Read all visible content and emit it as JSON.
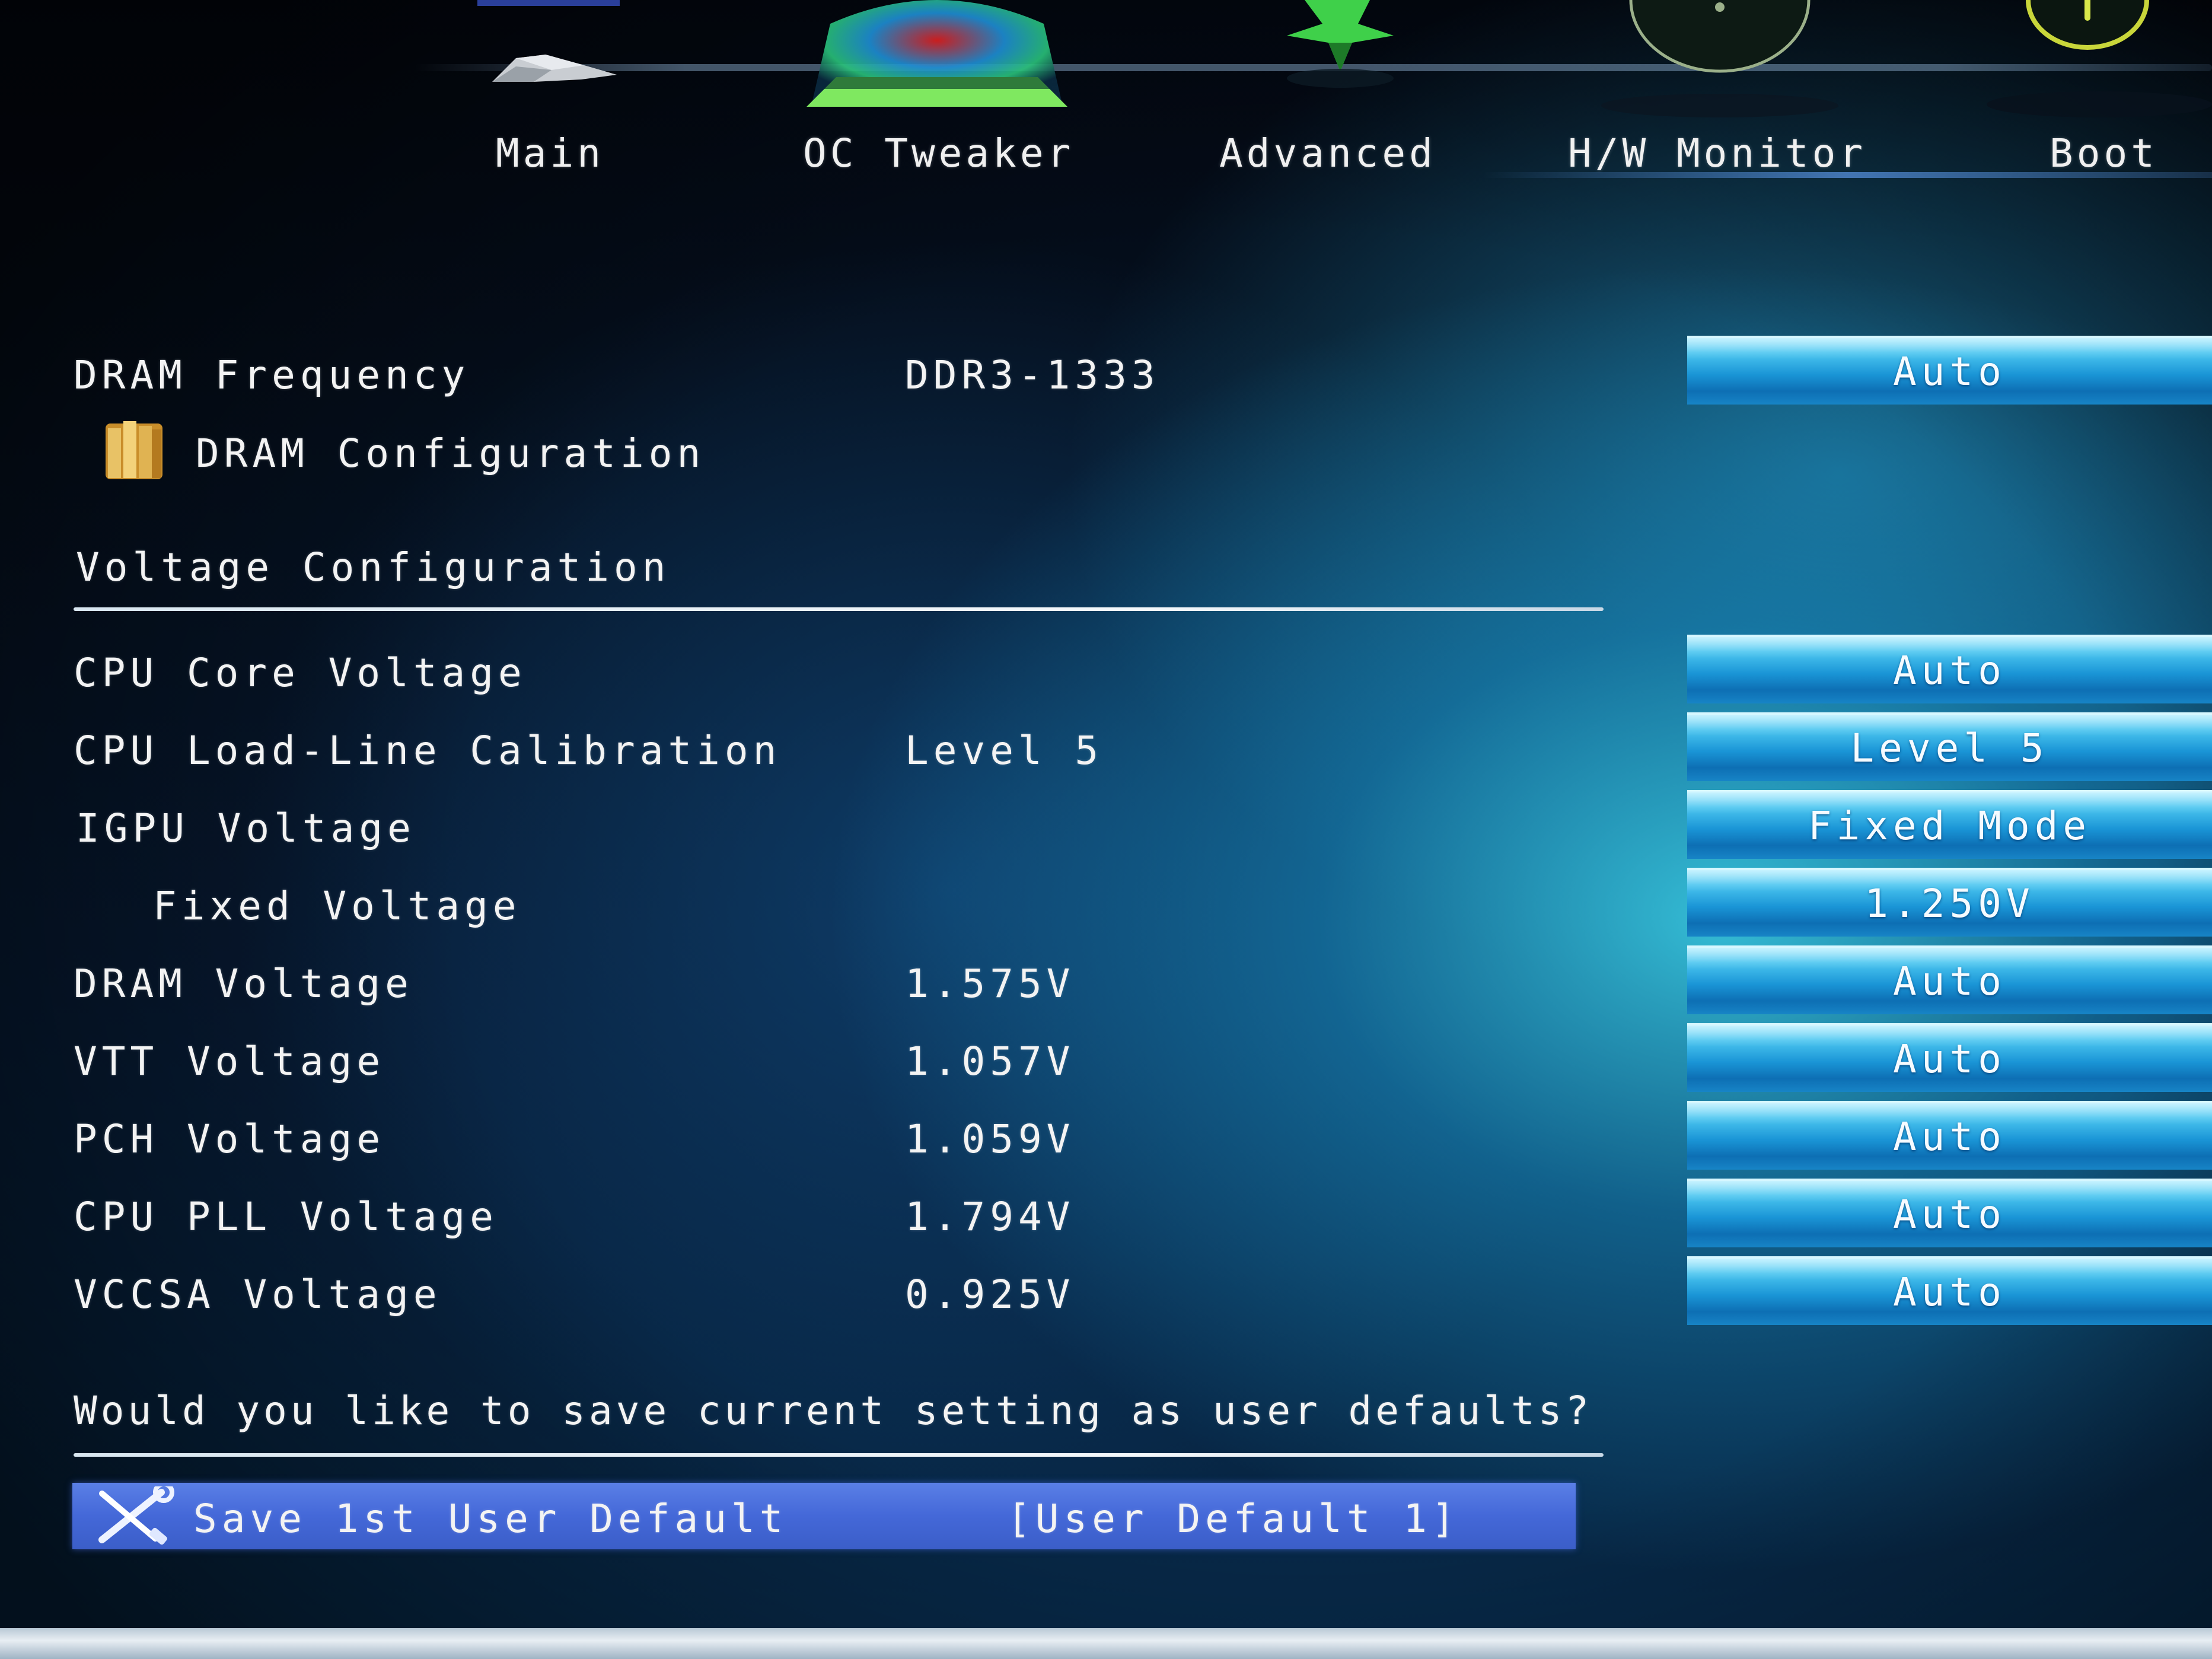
{
  "nav": {
    "tabs": [
      {
        "label": "Main",
        "icon": "chip-icon"
      },
      {
        "label": "OC Tweaker",
        "icon": "gauge-icon"
      },
      {
        "label": "Advanced",
        "icon": "star-icon"
      },
      {
        "label": "H/W Monitor",
        "icon": "monitor-gauge-icon"
      },
      {
        "label": "Boot",
        "icon": "power-icon"
      }
    ]
  },
  "settings": {
    "dram_frequency": {
      "label": "DRAM Frequency",
      "value": "DDR3-1333",
      "option": "Auto"
    },
    "dram_configuration": {
      "label": "DRAM Configuration",
      "icon": "folder-icon"
    },
    "voltage_section": {
      "label": "Voltage Configuration"
    },
    "rows": [
      {
        "label": "CPU Core Voltage",
        "value": "",
        "option": "Auto"
      },
      {
        "label": "CPU Load-Line Calibration",
        "value": "Level 5",
        "option": "Level 5"
      },
      {
        "label": "IGPU Voltage",
        "value": "",
        "option": "Fixed Mode"
      },
      {
        "label": "Fixed Voltage",
        "value": "",
        "option": "1.250V"
      },
      {
        "label": "DRAM Voltage",
        "value": "1.575V",
        "option": "Auto"
      },
      {
        "label": "VTT Voltage",
        "value": "1.057V",
        "option": "Auto"
      },
      {
        "label": "PCH Voltage",
        "value": "1.059V",
        "option": "Auto"
      },
      {
        "label": "CPU PLL Voltage",
        "value": "1.794V",
        "option": "Auto"
      },
      {
        "label": "VCCSA Voltage",
        "value": "0.925V",
        "option": "Auto"
      }
    ]
  },
  "user_defaults": {
    "prompt": "Would you like to save current setting as user defaults?",
    "save_item": {
      "label": "Save 1st User Default",
      "value": "[User Default 1]",
      "icon": "wrench-screwdriver-icon"
    }
  },
  "colors": {
    "option_button": "#1a95d6",
    "selected_row": "#4468d8",
    "text": "#f3f3f3"
  }
}
